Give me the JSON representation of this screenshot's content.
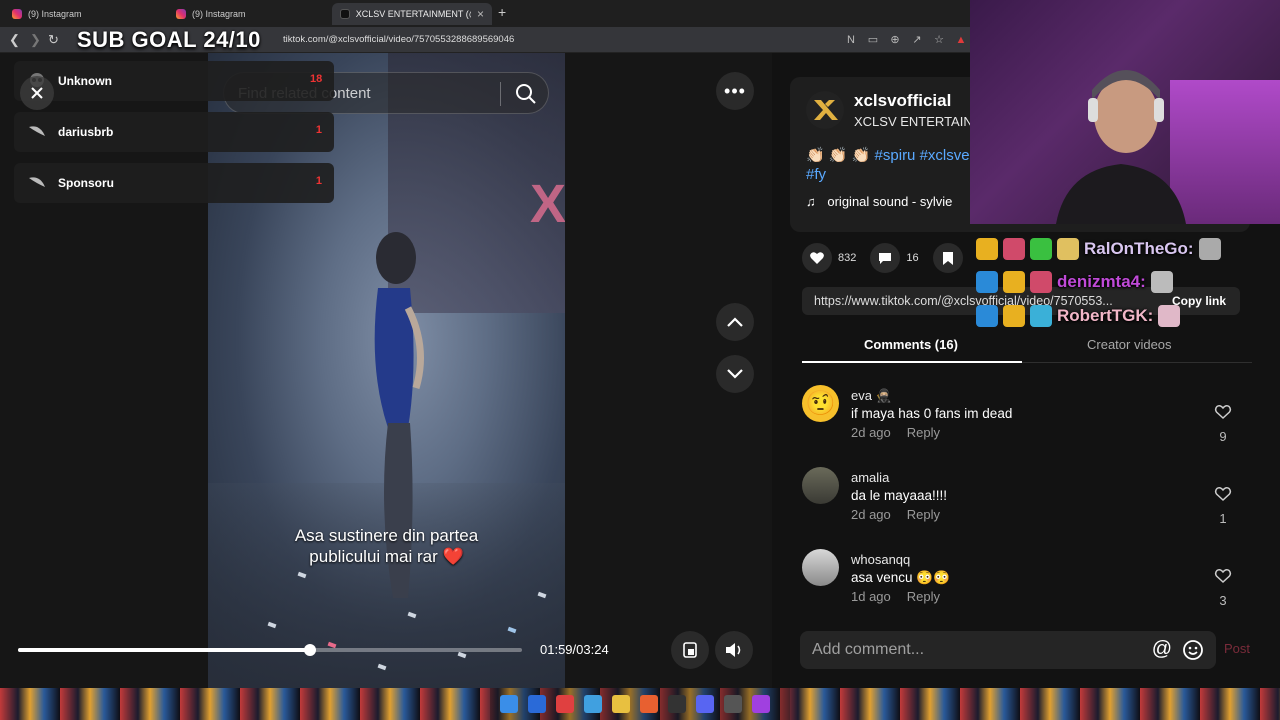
{
  "browser": {
    "tabs": [
      {
        "label": "(9) Instagram"
      },
      {
        "label": "(9) Instagram"
      },
      {
        "label": "XCLSV ENTERTAINMENT (@xcl"
      }
    ],
    "url": "tiktok.com/@xclsvofficial/video/7570553288689569046"
  },
  "stream": {
    "sub_goal": "SUB GOAL 24/10",
    "overlay_list": [
      {
        "name": "Unknown",
        "count": "18"
      },
      {
        "name": "dariusbrb",
        "count": "1"
      },
      {
        "name": "Sponsoru",
        "count": "1"
      }
    ],
    "chat_lines": [
      {
        "user": "RalOnTheGo:",
        "color": "#d9c6f0"
      },
      {
        "user": "denizmta4:",
        "color": "#c04ad8"
      },
      {
        "user": "RobertTGK:",
        "color": "#f2b7c8"
      }
    ]
  },
  "video": {
    "search_placeholder": "Find related content",
    "caption_line1": "Asa sustinere din partea",
    "caption_line2": "publicului mai rar ❤️",
    "time": "01:59/03:24",
    "progress": 0.58
  },
  "creator": {
    "username": "xclsvofficial",
    "display_name": "XCLSV ENTERTAINMENT",
    "desc_emojis": "👏🏻 👏🏻 👏🏻",
    "tag1": "#spiru",
    "tag2": "#xclsve",
    "tag3": "#fy",
    "music": "original sound - sylvie"
  },
  "actions": {
    "likes": "832",
    "comments": "16"
  },
  "share": {
    "link": "https://www.tiktok.com/@xclsvofficial/video/7570553...",
    "copy_label": "Copy link"
  },
  "tabs": {
    "comments": "Comments (16)",
    "creator_videos": "Creator videos"
  },
  "comments": [
    {
      "user": "eva 🥷🏼",
      "text": "if maya has 0 fans im dead",
      "age": "2d ago",
      "reply": "Reply",
      "likes": "9"
    },
    {
      "user": "amalia",
      "text": "da le mayaaa!!!!",
      "age": "2d ago",
      "reply": "Reply",
      "likes": "1"
    },
    {
      "user": "whosanqq",
      "text": "asa vencu 😳😳",
      "age": "1d ago",
      "reply": "Reply",
      "likes": "3"
    }
  ],
  "add_comment": {
    "placeholder": "Add comment...",
    "at": "@",
    "post": "Post"
  }
}
